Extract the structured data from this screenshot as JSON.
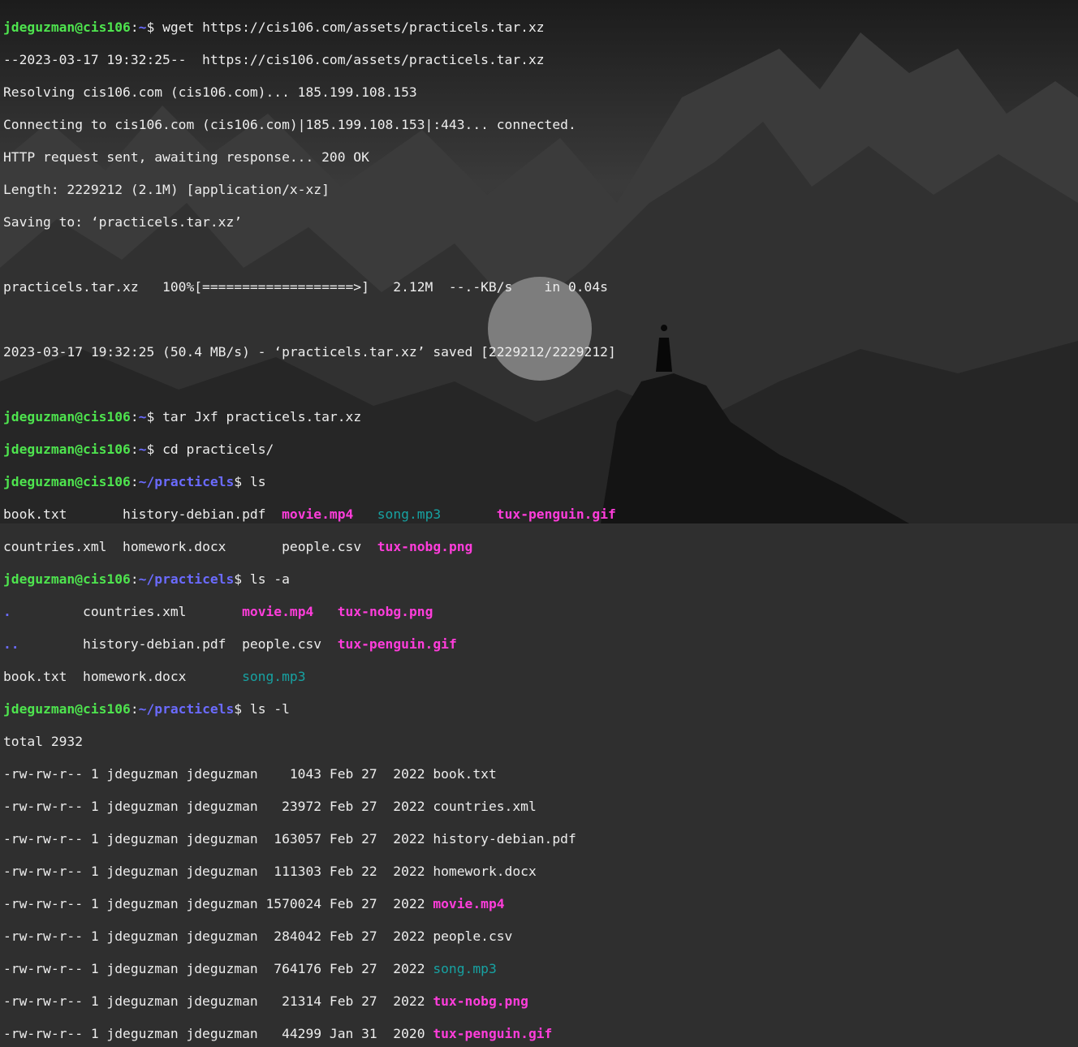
{
  "prompt": {
    "user_host": "jdeguzman@cis106",
    "home": "~",
    "dir": "~/practicels",
    "sep": ":",
    "sym": "$"
  },
  "colors": {
    "user": "#4ee44e",
    "path": "#6b6bff",
    "media": "#ff3ddb",
    "audio": "#17a2a2",
    "text": "#ededed"
  },
  "session": {
    "cmd1": " wget https://cis106.com/assets/practicels.tar.xz",
    "wget": [
      "--2023-03-17 19:32:25--  https://cis106.com/assets/practicels.tar.xz",
      "Resolving cis106.com (cis106.com)... 185.199.108.153",
      "Connecting to cis106.com (cis106.com)|185.199.108.153|:443... connected.",
      "HTTP request sent, awaiting response... 200 OK",
      "Length: 2229212 (2.1M) [application/x-xz]",
      "Saving to: ‘practicels.tar.xz’",
      "",
      "practicels.tar.xz   100%[===================>]   2.12M  --.-KB/s    in 0.04s",
      "",
      "2023-03-17 19:32:25 (50.4 MB/s) - ‘practicels.tar.xz’ saved [2229212/2229212]",
      ""
    ],
    "cmd2": " tar Jxf practicels.tar.xz",
    "cmd3": " cd practicels/",
    "cmd4": " ls",
    "ls1": {
      "book": "book.txt       ",
      "hist": "history-debian.pdf  ",
      "movie": "movie.mp4",
      "gap1": "   ",
      "song": "song.mp3",
      "gap2": "       ",
      "tuxgif": "tux-penguin.gif"
    },
    "ls2": {
      "countries": "countries.xml  ",
      "homework": "homework.docx       ",
      "people": "people.csv  ",
      "tuxpng": "tux-nobg.png"
    },
    "cmd5": " ls -a",
    "la1": {
      "dot": ".",
      "pad": "         ",
      "countries": "countries.xml       ",
      "movie": "movie.mp4",
      "gap": "   ",
      "tuxpng": "tux-nobg.png"
    },
    "la2": {
      "dotdot": "..",
      "pad": "        ",
      "hist": "history-debian.pdf  ",
      "people": "people.csv  ",
      "tuxgif": "tux-penguin.gif"
    },
    "la3": {
      "book": "book.txt  ",
      "homework": "homework.docx       ",
      "song": "song.mp3"
    },
    "cmd6": " ls -l",
    "total": "total 2932",
    "ll": [
      {
        "prefix": "-rw-rw-r-- 1 jdeguzman jdeguzman    1043 Feb 27  2022 ",
        "name": "book.txt",
        "type": "plain"
      },
      {
        "prefix": "-rw-rw-r-- 1 jdeguzman jdeguzman   23972 Feb 27  2022 ",
        "name": "countries.xml",
        "type": "plain"
      },
      {
        "prefix": "-rw-rw-r-- 1 jdeguzman jdeguzman  163057 Feb 27  2022 ",
        "name": "history-debian.pdf",
        "type": "plain"
      },
      {
        "prefix": "-rw-rw-r-- 1 jdeguzman jdeguzman  111303 Feb 22  2022 ",
        "name": "homework.docx",
        "type": "plain"
      },
      {
        "prefix": "-rw-rw-r-- 1 jdeguzman jdeguzman 1570024 Feb 27  2022 ",
        "name": "movie.mp4",
        "type": "media"
      },
      {
        "prefix": "-rw-rw-r-- 1 jdeguzman jdeguzman  284042 Feb 27  2022 ",
        "name": "people.csv",
        "type": "plain"
      },
      {
        "prefix": "-rw-rw-r-- 1 jdeguzman jdeguzman  764176 Feb 27  2022 ",
        "name": "song.mp3",
        "type": "audio"
      },
      {
        "prefix": "-rw-rw-r-- 1 jdeguzman jdeguzman   21314 Feb 27  2022 ",
        "name": "tux-nobg.png",
        "type": "media"
      },
      {
        "prefix": "-rw-rw-r-- 1 jdeguzman jdeguzman   44299 Jan 31  2020 ",
        "name": "tux-penguin.gif",
        "type": "media"
      }
    ]
  }
}
